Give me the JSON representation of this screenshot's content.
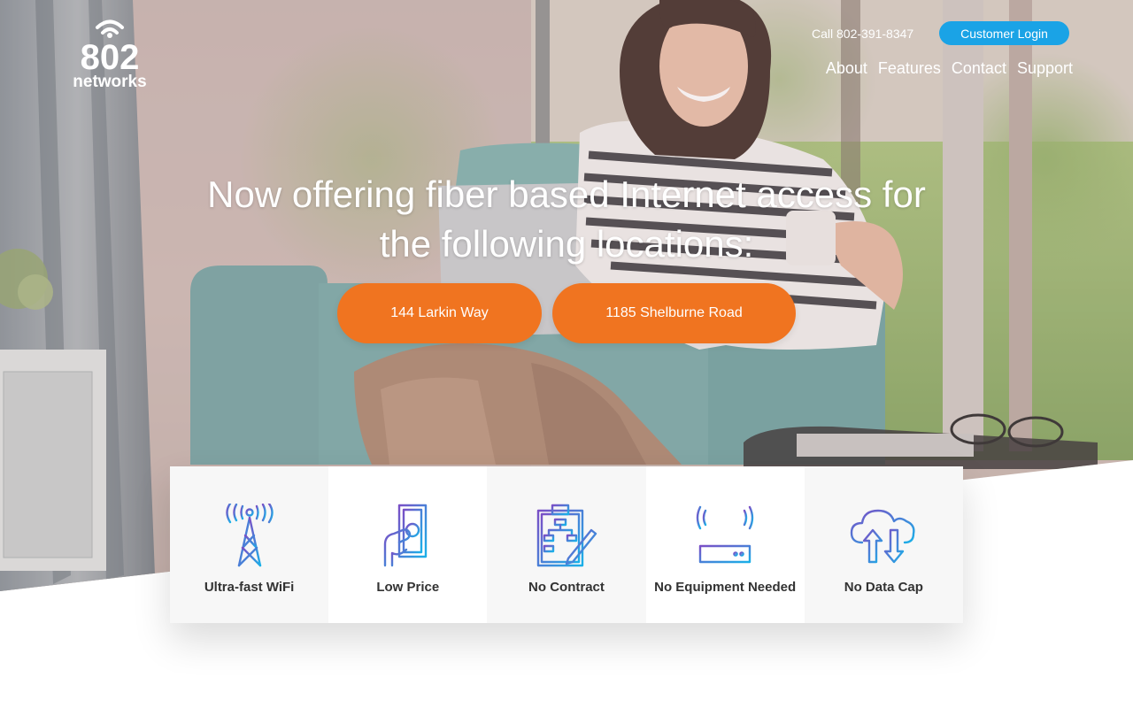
{
  "brand": {
    "logo_number": "802",
    "logo_word": "networks"
  },
  "header": {
    "phone": "Call 802-391-8347",
    "login_label": "Customer Login",
    "nav": [
      {
        "label": "About"
      },
      {
        "label": "Features"
      },
      {
        "label": "Contact"
      },
      {
        "label": "Support"
      }
    ]
  },
  "hero": {
    "headline_line1": "Now offering fiber based Internet access for",
    "headline_line2": "the following locations:",
    "locations": [
      {
        "label": "144 Larkin Way"
      },
      {
        "label": "1185 Shelburne Road"
      }
    ]
  },
  "features": [
    {
      "label": "Ultra-fast WiFi",
      "icon": "wifi-tower-icon"
    },
    {
      "label": "Low Price",
      "icon": "hand-cash-icon"
    },
    {
      "label": "No Contract",
      "icon": "clipboard-pen-icon"
    },
    {
      "label": "No Equipment Needed",
      "icon": "router-icon"
    },
    {
      "label": "No Data Cap",
      "icon": "cloud-transfer-icon"
    }
  ],
  "colors": {
    "accent_orange": "#f07420",
    "login_blue": "#1aa3e6",
    "icon_gradient_start": "#7a4fc6",
    "icon_gradient_end": "#1ab0e8"
  }
}
